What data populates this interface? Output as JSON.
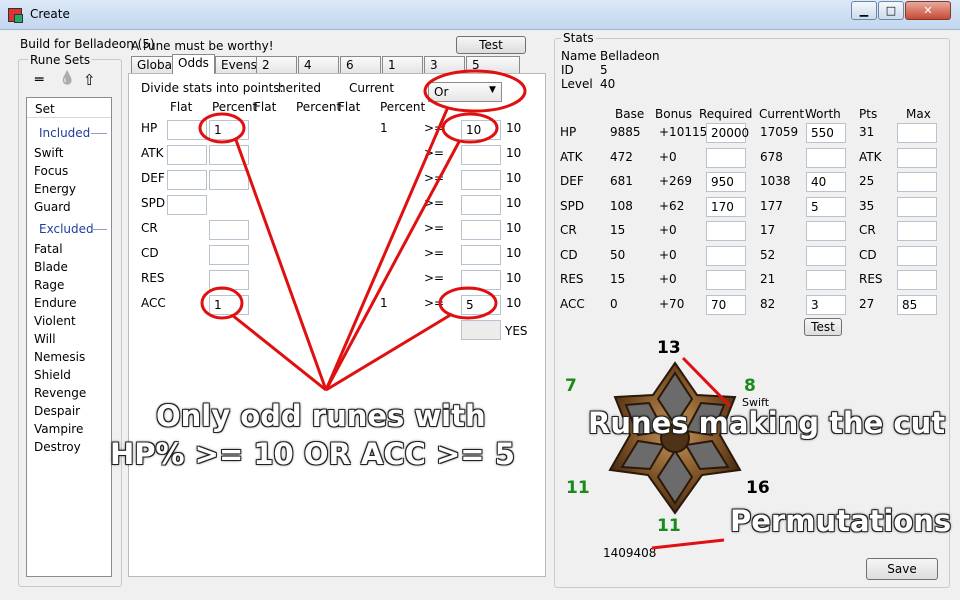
{
  "window": {
    "title": "Create",
    "min_label": "▁",
    "max_label": "□",
    "close_label": "✕"
  },
  "left": {
    "build_label": "Build for Belladeon (5)",
    "rune_sets_label": "Rune Sets",
    "toolbar_icons": [
      "equals-icon",
      "drop-icon",
      "up-arrow-icon"
    ],
    "toolbar_glyphs": [
      "═",
      "💧",
      "⇧"
    ],
    "list_header": "Set",
    "included_label": "Included",
    "included": [
      "Swift",
      "Focus",
      "Energy",
      "Guard"
    ],
    "excluded_label": "Excluded",
    "excluded": [
      "Fatal",
      "Blade",
      "Rage",
      "Endure",
      "Violent",
      "Will",
      "Nemesis",
      "Shield",
      "Revenge",
      "Despair",
      "Vampire",
      "Destroy"
    ]
  },
  "middle": {
    "worthy_label": "A rune must be worthy!",
    "test_button": "Test",
    "tabs": [
      "Global",
      "Odds",
      "Evens",
      "2",
      "4",
      "6",
      "1",
      "3",
      "5"
    ],
    "selected_tab": "Odds",
    "divide_label": "Divide stats into points:",
    "inherited_label": "herited",
    "current_label": "Current",
    "combine_value": "Or",
    "col_headers": [
      "Flat",
      "Percent",
      "Flat",
      "Percent",
      "Flat",
      "Percent"
    ],
    "stats": [
      "HP",
      "ATK",
      "DEF",
      "SPD",
      "CR",
      "CD",
      "RES",
      "ACC"
    ],
    "hp_percent": "1",
    "hp_third_percent": "1",
    "hp_ge": ">=",
    "hp_threshold": "10",
    "hp_current": "10",
    "ge_symbol": ">=",
    "current_values": [
      "10",
      "10",
      "10",
      "10",
      "10",
      "10",
      "10",
      "10"
    ],
    "acc_percent": "1",
    "acc_third_percent": "1",
    "acc_threshold": "5",
    "yes_label": "YES"
  },
  "stats": {
    "group_label": "Stats",
    "name_label": "Name",
    "name_value": "Belladeon",
    "id_label": "ID",
    "id_value": "5",
    "level_label": "Level",
    "level_value": "40",
    "headers": [
      "Base",
      "Bonus",
      "Required",
      "Current",
      "Worth",
      "Pts",
      "Max"
    ],
    "rows": [
      {
        "stat": "HP",
        "base": "9885",
        "bonus": "+10115",
        "required": "20000",
        "current": "17059",
        "worth": "550",
        "pts": "31",
        "max": ""
      },
      {
        "stat": "ATK",
        "base": "472",
        "bonus": "+0",
        "required": "",
        "current": "678",
        "worth": "",
        "pts": "ATK",
        "max": ""
      },
      {
        "stat": "DEF",
        "base": "681",
        "bonus": "+269",
        "required": "950",
        "current": "1038",
        "worth": "40",
        "pts": "25",
        "max": ""
      },
      {
        "stat": "SPD",
        "base": "108",
        "bonus": "+62",
        "required": "170",
        "current": "177",
        "worth": "5",
        "pts": "35",
        "max": ""
      },
      {
        "stat": "CR",
        "base": "15",
        "bonus": "+0",
        "required": "",
        "current": "17",
        "worth": "",
        "pts": "CR",
        "max": ""
      },
      {
        "stat": "CD",
        "base": "50",
        "bonus": "+0",
        "required": "",
        "current": "52",
        "worth": "",
        "pts": "CD",
        "max": ""
      },
      {
        "stat": "RES",
        "base": "15",
        "bonus": "+0",
        "required": "",
        "current": "21",
        "worth": "",
        "pts": "RES",
        "max": ""
      },
      {
        "stat": "ACC",
        "base": "0",
        "bonus": "+70",
        "required": "70",
        "current": "82",
        "worth": "3",
        "pts": "27",
        "max": "85"
      }
    ],
    "test_button": "Test"
  },
  "rune_wheel": {
    "slot_top": "13",
    "slot_top_right": "8",
    "slot_left": "7",
    "slot_bottom_left": "11",
    "slot_bottom_right": "16",
    "slot_bottom": "11",
    "set_label": "Swift",
    "permutations_value": "1409408",
    "colors": {
      "green": "#1a8a1a",
      "black": "#000000"
    }
  },
  "annotations": {
    "main_line1": "Only odd runes with",
    "main_line2": "HP% >= 10 OR ACC >= 5",
    "runes_cut": "Runes making the cut",
    "permutations": "Permutations",
    "circle_color": "#e01010"
  },
  "save_button": "Save"
}
